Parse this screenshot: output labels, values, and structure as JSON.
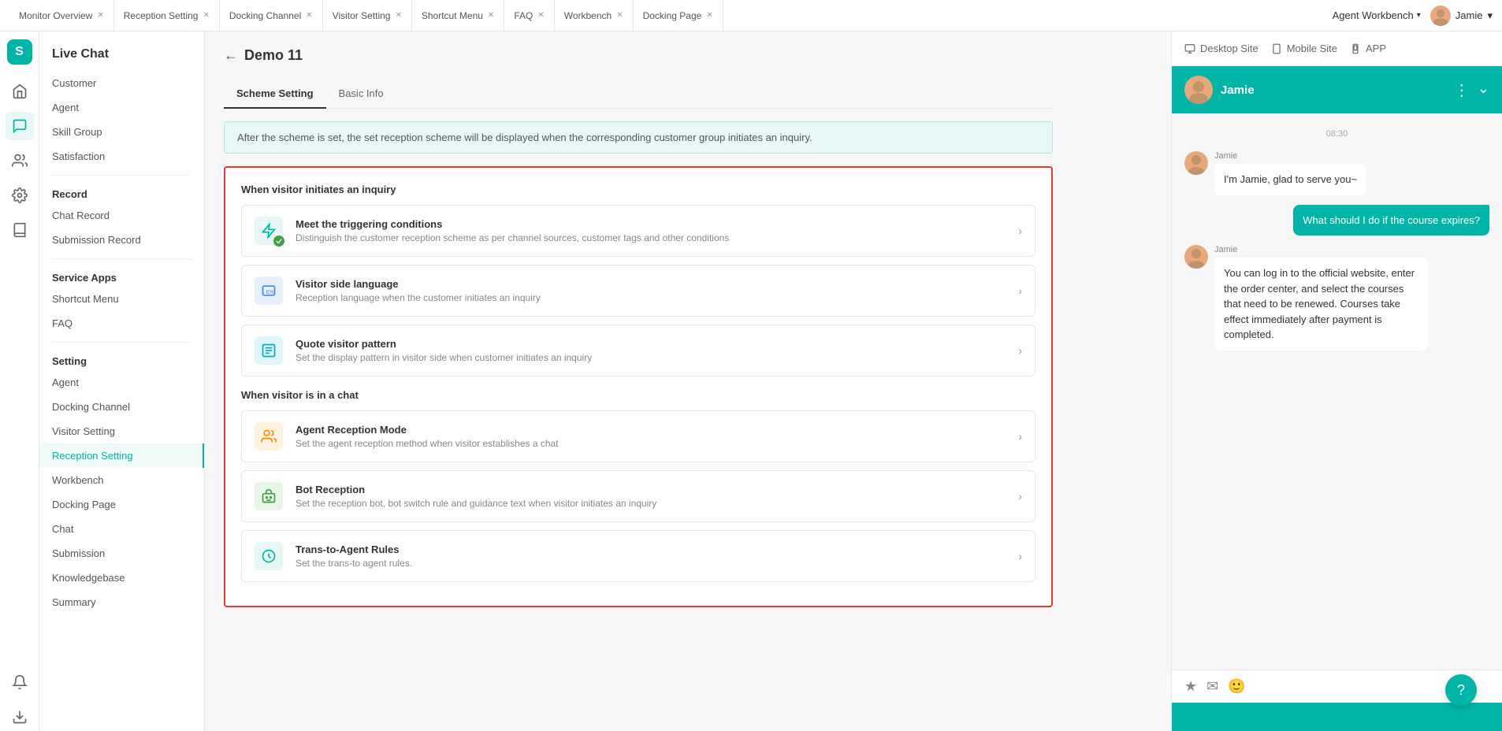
{
  "topbar": {
    "tabs": [
      {
        "label": "Monitor Overview",
        "closable": true
      },
      {
        "label": "Reception Setting",
        "closable": true
      },
      {
        "label": "Docking Channel",
        "closable": true
      },
      {
        "label": "Visitor Setting",
        "closable": true
      },
      {
        "label": "Shortcut Menu",
        "closable": true
      },
      {
        "label": "FAQ",
        "closable": true
      },
      {
        "label": "Workbench",
        "closable": true
      },
      {
        "label": "Docking Page",
        "closable": true
      }
    ],
    "agent_workbench": "Agent Workbench",
    "user_name": "Jamie",
    "dropdown_arrow": "▾"
  },
  "sidebar": {
    "logo": "S",
    "nav_title": "Live Chat",
    "sections": [
      {
        "items": [
          {
            "label": "Customer"
          },
          {
            "label": "Agent"
          },
          {
            "label": "Skill Group"
          },
          {
            "label": "Satisfaction"
          }
        ]
      },
      {
        "title": "Record",
        "items": [
          {
            "label": "Chat Record"
          },
          {
            "label": "Submission Record"
          }
        ]
      },
      {
        "title": "Service Apps",
        "items": [
          {
            "label": "Shortcut Menu"
          },
          {
            "label": "FAQ"
          }
        ]
      },
      {
        "title": "Setting",
        "items": [
          {
            "label": "Agent"
          },
          {
            "label": "Docking Channel"
          },
          {
            "label": "Visitor Setting"
          },
          {
            "label": "Reception Setting",
            "active": true
          },
          {
            "label": "Workbench"
          },
          {
            "label": "Docking Page"
          },
          {
            "label": "Chat"
          },
          {
            "label": "Submission"
          },
          {
            "label": "Knowledgebase"
          },
          {
            "label": "Summary"
          }
        ]
      }
    ]
  },
  "page": {
    "back_label": "←",
    "title": "Demo 11",
    "tabs": [
      {
        "label": "Scheme Setting",
        "active": true
      },
      {
        "label": "Basic Info"
      }
    ],
    "info_banner": "After the scheme is set, the set reception scheme will be displayed when the corresponding customer group initiates an inquiry.",
    "section_label_inquiry": "When visitor initiates an inquiry",
    "settings_inquiry": [
      {
        "title": "Meet the triggering conditions",
        "desc": "Distinguish the customer reception scheme as per channel sources, customer tags and other conditions",
        "icon_type": "trigger"
      },
      {
        "title": "Visitor side language",
        "desc": "Reception language when the customer initiates an inquiry",
        "icon_type": "language"
      },
      {
        "title": "Quote visitor pattern",
        "desc": "Set the display pattern in visitor side when customer initiates an inquiry",
        "icon_type": "quote"
      }
    ],
    "section_label_chat": "When visitor is in a chat",
    "settings_chat": [
      {
        "title": "Agent Reception Mode",
        "desc": "Set the agent reception method when visitor establishes a chat",
        "icon_type": "agent-mode"
      },
      {
        "title": "Bot Reception",
        "desc": "Set the reception bot, bot switch rule and guidance text when visitor initiates an inquiry",
        "icon_type": "bot"
      },
      {
        "title": "Trans-to-Agent Rules",
        "desc": "Set the trans-to agent rules.",
        "icon_type": "trans"
      }
    ]
  },
  "chat_panel": {
    "tabs": [
      {
        "label": "Desktop Site",
        "icon": "desktop"
      },
      {
        "label": "Mobile Site",
        "icon": "mobile"
      },
      {
        "label": "APP",
        "icon": "app"
      }
    ],
    "header": {
      "name": "Jamie",
      "time": "08:30"
    },
    "messages": [
      {
        "sender": "Jamie",
        "text": "I'm Jamie, glad to serve you~",
        "side": "left"
      },
      {
        "sender": "visitor",
        "text": "What should I do if the course expires?",
        "side": "right"
      },
      {
        "sender": "Jamie",
        "text": "You can log in to the official website, enter the order center, and select the courses that need to be renewed. Courses take effect immediately after payment is completed.",
        "side": "left"
      }
    ],
    "footer_icons": [
      "star",
      "mail",
      "emoji"
    ]
  }
}
